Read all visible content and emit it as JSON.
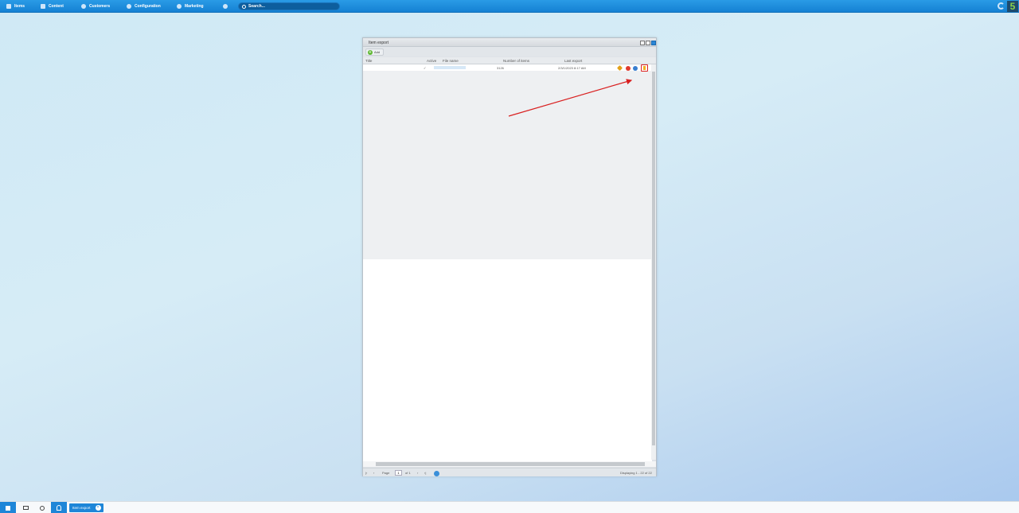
{
  "menu": {
    "items": [
      {
        "label": "Items",
        "icon": "items-icon"
      },
      {
        "label": "Content",
        "icon": "content-icon"
      },
      {
        "label": "Customers",
        "icon": "customers-icon"
      },
      {
        "label": "Configuration",
        "icon": "configuration-icon"
      },
      {
        "label": "Marketing",
        "icon": "marketing-icon"
      }
    ],
    "help_icon": "help-icon",
    "search_placeholder": "Search..."
  },
  "logo": {
    "text": "5"
  },
  "window": {
    "title": "Item export",
    "toolbar": {
      "add_label": "Add"
    },
    "columns": [
      "Title",
      "Active",
      "File name",
      "Number of items",
      "Last export"
    ],
    "rows": [
      {
        "title": "",
        "active": "✓",
        "file_name": "",
        "number_of_items": "3126",
        "last_export": "2/3/1/2023 8:17 AM"
      }
    ],
    "pager": {
      "page_label": "Page",
      "page_value": "1",
      "of_label": "of 1",
      "display_info": "Displaying 1 - 22 of 22"
    }
  },
  "taskbar": {
    "task_label": "Item export"
  },
  "colors": {
    "topbar": "#1a8ae0",
    "accent": "#1e86d8",
    "annotation": "#d92020"
  }
}
